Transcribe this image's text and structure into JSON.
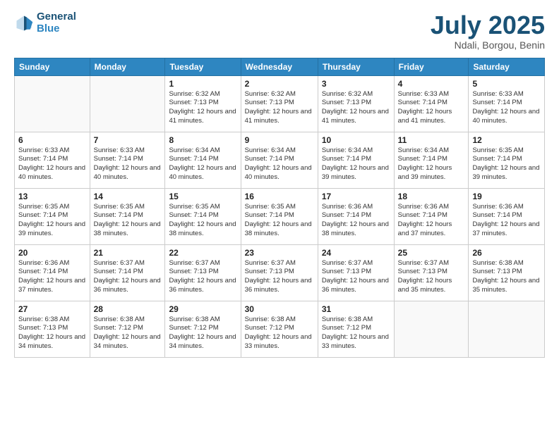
{
  "header": {
    "logo_line1": "General",
    "logo_line2": "Blue",
    "month": "July 2025",
    "location": "Ndali, Borgou, Benin"
  },
  "weekdays": [
    "Sunday",
    "Monday",
    "Tuesday",
    "Wednesday",
    "Thursday",
    "Friday",
    "Saturday"
  ],
  "weeks": [
    [
      {
        "day": "",
        "info": ""
      },
      {
        "day": "",
        "info": ""
      },
      {
        "day": "1",
        "info": "Sunrise: 6:32 AM\nSunset: 7:13 PM\nDaylight: 12 hours and 41 minutes."
      },
      {
        "day": "2",
        "info": "Sunrise: 6:32 AM\nSunset: 7:13 PM\nDaylight: 12 hours and 41 minutes."
      },
      {
        "day": "3",
        "info": "Sunrise: 6:32 AM\nSunset: 7:13 PM\nDaylight: 12 hours and 41 minutes."
      },
      {
        "day": "4",
        "info": "Sunrise: 6:33 AM\nSunset: 7:14 PM\nDaylight: 12 hours and 41 minutes."
      },
      {
        "day": "5",
        "info": "Sunrise: 6:33 AM\nSunset: 7:14 PM\nDaylight: 12 hours and 40 minutes."
      }
    ],
    [
      {
        "day": "6",
        "info": "Sunrise: 6:33 AM\nSunset: 7:14 PM\nDaylight: 12 hours and 40 minutes."
      },
      {
        "day": "7",
        "info": "Sunrise: 6:33 AM\nSunset: 7:14 PM\nDaylight: 12 hours and 40 minutes."
      },
      {
        "day": "8",
        "info": "Sunrise: 6:34 AM\nSunset: 7:14 PM\nDaylight: 12 hours and 40 minutes."
      },
      {
        "day": "9",
        "info": "Sunrise: 6:34 AM\nSunset: 7:14 PM\nDaylight: 12 hours and 40 minutes."
      },
      {
        "day": "10",
        "info": "Sunrise: 6:34 AM\nSunset: 7:14 PM\nDaylight: 12 hours and 39 minutes."
      },
      {
        "day": "11",
        "info": "Sunrise: 6:34 AM\nSunset: 7:14 PM\nDaylight: 12 hours and 39 minutes."
      },
      {
        "day": "12",
        "info": "Sunrise: 6:35 AM\nSunset: 7:14 PM\nDaylight: 12 hours and 39 minutes."
      }
    ],
    [
      {
        "day": "13",
        "info": "Sunrise: 6:35 AM\nSunset: 7:14 PM\nDaylight: 12 hours and 39 minutes."
      },
      {
        "day": "14",
        "info": "Sunrise: 6:35 AM\nSunset: 7:14 PM\nDaylight: 12 hours and 38 minutes."
      },
      {
        "day": "15",
        "info": "Sunrise: 6:35 AM\nSunset: 7:14 PM\nDaylight: 12 hours and 38 minutes."
      },
      {
        "day": "16",
        "info": "Sunrise: 6:35 AM\nSunset: 7:14 PM\nDaylight: 12 hours and 38 minutes."
      },
      {
        "day": "17",
        "info": "Sunrise: 6:36 AM\nSunset: 7:14 PM\nDaylight: 12 hours and 38 minutes."
      },
      {
        "day": "18",
        "info": "Sunrise: 6:36 AM\nSunset: 7:14 PM\nDaylight: 12 hours and 37 minutes."
      },
      {
        "day": "19",
        "info": "Sunrise: 6:36 AM\nSunset: 7:14 PM\nDaylight: 12 hours and 37 minutes."
      }
    ],
    [
      {
        "day": "20",
        "info": "Sunrise: 6:36 AM\nSunset: 7:14 PM\nDaylight: 12 hours and 37 minutes."
      },
      {
        "day": "21",
        "info": "Sunrise: 6:37 AM\nSunset: 7:14 PM\nDaylight: 12 hours and 36 minutes."
      },
      {
        "day": "22",
        "info": "Sunrise: 6:37 AM\nSunset: 7:13 PM\nDaylight: 12 hours and 36 minutes."
      },
      {
        "day": "23",
        "info": "Sunrise: 6:37 AM\nSunset: 7:13 PM\nDaylight: 12 hours and 36 minutes."
      },
      {
        "day": "24",
        "info": "Sunrise: 6:37 AM\nSunset: 7:13 PM\nDaylight: 12 hours and 36 minutes."
      },
      {
        "day": "25",
        "info": "Sunrise: 6:37 AM\nSunset: 7:13 PM\nDaylight: 12 hours and 35 minutes."
      },
      {
        "day": "26",
        "info": "Sunrise: 6:38 AM\nSunset: 7:13 PM\nDaylight: 12 hours and 35 minutes."
      }
    ],
    [
      {
        "day": "27",
        "info": "Sunrise: 6:38 AM\nSunset: 7:13 PM\nDaylight: 12 hours and 34 minutes."
      },
      {
        "day": "28",
        "info": "Sunrise: 6:38 AM\nSunset: 7:12 PM\nDaylight: 12 hours and 34 minutes."
      },
      {
        "day": "29",
        "info": "Sunrise: 6:38 AM\nSunset: 7:12 PM\nDaylight: 12 hours and 34 minutes."
      },
      {
        "day": "30",
        "info": "Sunrise: 6:38 AM\nSunset: 7:12 PM\nDaylight: 12 hours and 33 minutes."
      },
      {
        "day": "31",
        "info": "Sunrise: 6:38 AM\nSunset: 7:12 PM\nDaylight: 12 hours and 33 minutes."
      },
      {
        "day": "",
        "info": ""
      },
      {
        "day": "",
        "info": ""
      }
    ]
  ]
}
